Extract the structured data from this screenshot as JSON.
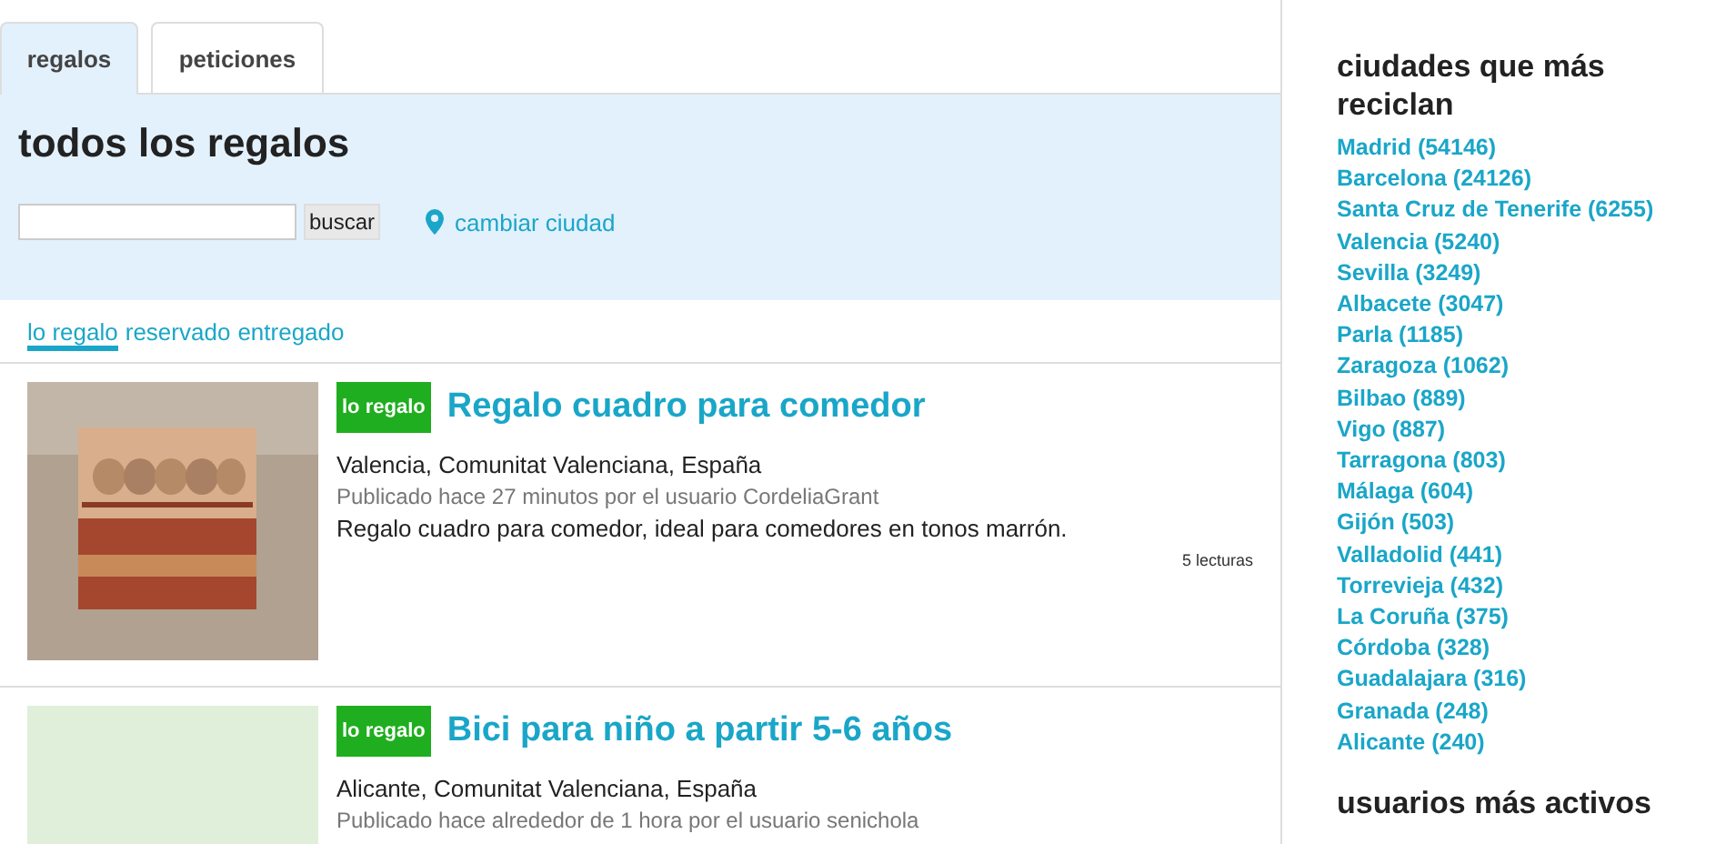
{
  "tabs": [
    {
      "label": "regalos",
      "selected": true
    },
    {
      "label": "peticiones",
      "selected": false
    }
  ],
  "panel": {
    "title": "todos los regalos",
    "search_button": "buscar",
    "city_link": "cambiar ciudad"
  },
  "filters": [
    {
      "label": "lo regalo",
      "selected": true
    },
    {
      "label": "reservado",
      "selected": false
    },
    {
      "label": "entregado",
      "selected": false
    }
  ],
  "items": [
    {
      "badge": "lo regalo",
      "title": "Regalo cuadro para comedor",
      "location": "Valencia, Comunitat Valenciana, España",
      "meta": "Publicado hace 27 minutos por el usuario CordeliaGrant",
      "description": "Regalo cuadro para comedor, ideal para comedores en tonos marrón.",
      "reads": "5 lecturas"
    },
    {
      "image": {
        "kind": "placeholder"
      },
      "badge": "lo regalo",
      "title": "Bici para niño a partir 5-6 años",
      "location": "Alicante, Comunitat Valenciana, España",
      "meta": "Publicado hace alrededor de 1 hora por el usuario senichola"
    }
  ],
  "sidebar": {
    "heading": "ciudades que más reciclan",
    "cities": [
      "Madrid (54146)",
      "Barcelona (24126)",
      "Santa Cruz de Tenerife (6255)",
      "Valencia (5240)",
      "Sevilla (3249)",
      "Albacete (3047)",
      "Parla (1185)",
      "Zaragoza (1062)",
      "Bilbao (889)",
      "Vigo (887)",
      "Tarragona (803)",
      "Málaga (604)",
      "Gijón (503)",
      "Valladolid (441)",
      "Torrevieja (432)",
      "La Coruña (375)",
      "Córdoba (328)",
      "Guadalajara (316)",
      "Granada (248)",
      "Alicante (240)"
    ],
    "heading_2": "usuarios más activos"
  }
}
